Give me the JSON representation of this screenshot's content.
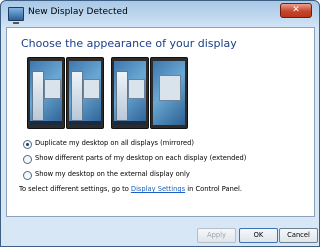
{
  "window": {
    "title": "New Display Detected",
    "close_label": "✕"
  },
  "heading": "Choose the appearance of your display",
  "previews": [
    {
      "name": "mirrored-preview"
    },
    {
      "name": "extended-preview"
    }
  ],
  "options": [
    {
      "label": "Duplicate my desktop on all displays (mirrored)",
      "checked": true
    },
    {
      "label": "Show different parts of my desktop on each display (extended)",
      "checked": false
    },
    {
      "label": "Show my desktop on the external display only",
      "checked": false
    }
  ],
  "info": {
    "prefix": "To select different settings, go to ",
    "link": "Display Settings",
    "suffix": " in Control Panel."
  },
  "buttons": {
    "apply": "Apply",
    "ok": "OK",
    "cancel": "Cancel"
  }
}
